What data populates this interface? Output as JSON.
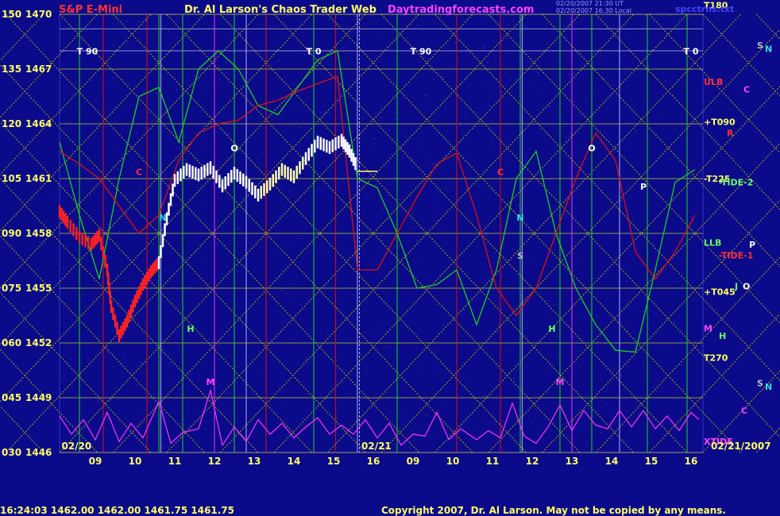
{
  "header": {
    "left_title": "S&P E-Mini",
    "center_title": "Dr. Al Larson's Chaos Trader Web",
    "site": "Daytradingforecasts.com",
    "stamp_line1": "02/20/2007 21:30 UT",
    "stamp_line2": "02/20/2007 16:30 Local",
    "file": "spcctrns.txt"
  },
  "footer": {
    "time_quote": "16:24:03  1462.00  1462.00  1461.75  1461.75",
    "copyright": "Copyright 2007, Dr. Al Larson. May not be copied by any means."
  },
  "colors": {
    "background": "#0a0a8a",
    "grid_yellow": "#c8c800",
    "green_line": "#22cc22",
    "red_line": "#dd1111",
    "magenta_line": "#ee33ee",
    "price_bar": "#ffffff"
  },
  "chart_data": {
    "type": "line",
    "title": "S&P E-Mini",
    "y_ticks": [
      {
        "code": "150",
        "price": 1470
      },
      {
        "code": "135",
        "price": 1467
      },
      {
        "code": "120",
        "price": 1464
      },
      {
        "code": "105",
        "price": 1461
      },
      {
        "code": "090",
        "price": 1458
      },
      {
        "code": "075",
        "price": 1455
      },
      {
        "code": "060",
        "price": 1452
      },
      {
        "code": "045",
        "price": 1449
      },
      {
        "code": "030",
        "price": 1446
      }
    ],
    "ylim": [
      1446,
      1470
    ],
    "x_hours_day1": [
      "09",
      "10",
      "11",
      "12",
      "13",
      "14",
      "15",
      "16"
    ],
    "x_hours_day2": [
      "09",
      "10",
      "11",
      "12",
      "13",
      "14",
      "15",
      "16"
    ],
    "x_dates": [
      "02/20",
      "02/21"
    ],
    "date_label_right": "02/21/2007",
    "price_path": [
      [
        8.5,
        1459.2
      ],
      [
        8.7,
        1458.6
      ],
      [
        9.0,
        1457.8
      ],
      [
        9.3,
        1457.4
      ],
      [
        9.5,
        1457.9
      ],
      [
        9.7,
        1456.0
      ],
      [
        9.8,
        1454.0
      ],
      [
        10.0,
        1452.4
      ],
      [
        10.2,
        1453.2
      ],
      [
        10.4,
        1454.3
      ],
      [
        10.6,
        1455.2
      ],
      [
        10.8,
        1455.9
      ],
      [
        11.0,
        1456.4
      ],
      [
        11.2,
        1458.8
      ],
      [
        11.4,
        1460.9
      ],
      [
        11.7,
        1461.5
      ],
      [
        12.0,
        1461.2
      ],
      [
        12.3,
        1461.6
      ],
      [
        12.6,
        1460.6
      ],
      [
        12.9,
        1461.3
      ],
      [
        13.2,
        1460.8
      ],
      [
        13.5,
        1460.1
      ],
      [
        13.8,
        1460.7
      ],
      [
        14.1,
        1461.5
      ],
      [
        14.4,
        1461.1
      ],
      [
        14.7,
        1462.1
      ],
      [
        15.0,
        1463.0
      ],
      [
        15.3,
        1462.7
      ],
      [
        15.6,
        1463.1
      ],
      [
        15.8,
        1462.5
      ],
      [
        16.0,
        1461.6
      ]
    ],
    "green_path": [
      [
        8.5,
        1463
      ],
      [
        9.0,
        1459
      ],
      [
        9.5,
        1455.5
      ],
      [
        10.0,
        1461
      ],
      [
        10.5,
        1465.5
      ],
      [
        11.0,
        1466
      ],
      [
        11.5,
        1463
      ],
      [
        12.0,
        1467
      ],
      [
        12.5,
        1468
      ],
      [
        13.0,
        1467
      ],
      [
        13.5,
        1465
      ],
      [
        14.0,
        1464.5
      ],
      [
        14.5,
        1466
      ],
      [
        15.0,
        1467.5
      ],
      [
        15.5,
        1468
      ],
      [
        16.0,
        1461
      ],
      [
        16.5,
        1460.5
      ],
      [
        17.0,
        1458
      ],
      [
        17.5,
        1455
      ],
      [
        18.0,
        1455.2
      ],
      [
        18.5,
        1456
      ],
      [
        19.0,
        1453
      ],
      [
        19.5,
        1456
      ],
      [
        20.0,
        1461
      ],
      [
        20.5,
        1462.5
      ],
      [
        21.0,
        1458
      ],
      [
        21.5,
        1455
      ],
      [
        22.0,
        1453
      ],
      [
        22.5,
        1451.6
      ],
      [
        23.0,
        1451.5
      ],
      [
        23.5,
        1456
      ],
      [
        24.0,
        1460.8
      ],
      [
        24.5,
        1461.5
      ]
    ],
    "red_path": [
      [
        8.5,
        1462.5
      ],
      [
        9.0,
        1461.8
      ],
      [
        9.5,
        1461.0
      ],
      [
        10.0,
        1459.5
      ],
      [
        10.5,
        1458
      ],
      [
        11.0,
        1459
      ],
      [
        11.5,
        1462
      ],
      [
        12.0,
        1463.5
      ],
      [
        12.5,
        1464
      ],
      [
        13.0,
        1464.2
      ],
      [
        13.5,
        1465
      ],
      [
        14.0,
        1465.3
      ],
      [
        14.5,
        1465.8
      ],
      [
        15.0,
        1466.2
      ],
      [
        15.5,
        1466.6
      ],
      [
        16.0,
        1456
      ],
      [
        16.5,
        1456
      ],
      [
        17.0,
        1458
      ],
      [
        17.5,
        1460
      ],
      [
        18.0,
        1461.8
      ],
      [
        18.5,
        1462.4
      ],
      [
        19.0,
        1459
      ],
      [
        19.5,
        1455
      ],
      [
        20.0,
        1453.5
      ],
      [
        20.5,
        1455
      ],
      [
        21.0,
        1458
      ],
      [
        21.5,
        1461
      ],
      [
        22.0,
        1463.5
      ],
      [
        22.5,
        1462
      ],
      [
        23.0,
        1457
      ],
      [
        23.5,
        1455.5
      ],
      [
        24.0,
        1457
      ],
      [
        24.5,
        1459
      ]
    ],
    "magenta_path": [
      [
        8.5,
        1448
      ],
      [
        8.8,
        1447
      ],
      [
        9.1,
        1447.8
      ],
      [
        9.4,
        1446.7
      ],
      [
        9.7,
        1448.2
      ],
      [
        10.0,
        1446.6
      ],
      [
        10.3,
        1447.6
      ],
      [
        10.6,
        1446.8
      ],
      [
        11.0,
        1448.8
      ],
      [
        11.3,
        1446.5
      ],
      [
        11.6,
        1447.1
      ],
      [
        12.0,
        1447.3
      ],
      [
        12.3,
        1449.4
      ],
      [
        12.6,
        1446.4
      ],
      [
        12.9,
        1447.4
      ],
      [
        13.2,
        1446.6
      ],
      [
        13.5,
        1447.8
      ],
      [
        13.8,
        1447.0
      ],
      [
        14.1,
        1447.6
      ],
      [
        14.4,
        1446.8
      ],
      [
        14.7,
        1447.4
      ],
      [
        15.0,
        1447.9
      ],
      [
        15.3,
        1447.0
      ],
      [
        15.6,
        1447.5
      ],
      [
        15.9,
        1447.0
      ],
      [
        16.2,
        1447.8
      ],
      [
        16.5,
        1446.8
      ],
      [
        16.8,
        1447.6
      ],
      [
        17.1,
        1446.4
      ],
      [
        17.4,
        1447.0
      ],
      [
        17.7,
        1446.9
      ],
      [
        18.0,
        1448.2
      ],
      [
        18.3,
        1446.7
      ],
      [
        18.6,
        1447.3
      ],
      [
        19.0,
        1446.7
      ],
      [
        19.3,
        1447.2
      ],
      [
        19.6,
        1446.8
      ],
      [
        19.9,
        1448.7
      ],
      [
        20.2,
        1446.9
      ],
      [
        20.5,
        1446.5
      ],
      [
        20.8,
        1447.4
      ],
      [
        21.1,
        1448.6
      ],
      [
        21.4,
        1447.2
      ],
      [
        21.7,
        1448.3
      ],
      [
        22.0,
        1447.5
      ],
      [
        22.3,
        1447.3
      ],
      [
        22.6,
        1448.3
      ],
      [
        22.9,
        1447.4
      ],
      [
        23.2,
        1448.3
      ],
      [
        23.5,
        1447.3
      ],
      [
        23.8,
        1448.0
      ],
      [
        24.1,
        1447.2
      ],
      [
        24.4,
        1448.2
      ],
      [
        24.6,
        1447.8
      ]
    ],
    "right_levels": [
      {
        "label": "T180",
        "price": 1470.5,
        "color": "#ffff66"
      },
      {
        "label": "ULB",
        "price": 1466.3,
        "color": "#ff3333"
      },
      {
        "label": "+T090",
        "price": 1464.1,
        "color": "#ffff66"
      },
      {
        "label": "-T225",
        "price": 1461.0,
        "color": "#ffff66"
      },
      {
        "label": "LLB",
        "price": 1457.5,
        "color": "#66ff66"
      },
      {
        "label": "+T045",
        "price": 1454.8,
        "color": "#ffff66"
      },
      {
        "label": "M",
        "price": 1452.8,
        "color": "#ff44ff"
      },
      {
        "label": "T270",
        "price": 1451.2,
        "color": "#ffff66"
      },
      {
        "label": "XTIDE",
        "price": 1446.6,
        "color": "#ff44ff"
      }
    ],
    "side_labels": [
      {
        "label": "S",
        "y": 1468.3,
        "side": 953,
        "color": "#bbbbbb"
      },
      {
        "label": "N",
        "y": 1468.1,
        "side": 963,
        "color": "#33dddd"
      },
      {
        "label": "C",
        "y": 1465.9,
        "side": 936,
        "color": "#ff44ff"
      },
      {
        "label": "R",
        "y": 1463.5,
        "side": 915,
        "color": "#ff3333"
      },
      {
        "label": "-TIDE-2",
        "y": 1460.8,
        "side": 905,
        "color": "#66ff66"
      },
      {
        "label": "P",
        "y": 1457.4,
        "side": 943,
        "color": "#ffffff"
      },
      {
        "label": "-TIDE-1",
        "y": 1456.8,
        "side": 905,
        "color": "#ff3333"
      },
      {
        "label": "J",
        "y": 1455.1,
        "side": 925,
        "color": "#66ff66"
      },
      {
        "label": "O",
        "y": 1455.1,
        "side": 935,
        "color": "#ffffff"
      },
      {
        "label": "H",
        "y": 1452.4,
        "side": 905,
        "color": "#66ff66"
      },
      {
        "label": "S",
        "y": 1449.8,
        "side": 953,
        "color": "#bbbbbb"
      },
      {
        "label": "N",
        "y": 1449.6,
        "side": 963,
        "color": "#33dddd"
      },
      {
        "label": "C",
        "y": 1448.3,
        "side": 933,
        "color": "#ff44ff"
      }
    ],
    "annotations": [
      {
        "label": "T 90",
        "x": 9.2,
        "y": 1467.8,
        "color": "#ffffff"
      },
      {
        "label": "T 0",
        "x": 14.9,
        "y": 1467.8,
        "color": "#ffffff"
      },
      {
        "label": "T 90",
        "x": 17.6,
        "y": 1467.8,
        "color": "#ffffff"
      },
      {
        "label": "T 0",
        "x": 24.4,
        "y": 1467.8,
        "color": "#ffffff"
      },
      {
        "label": "O",
        "x": 12.9,
        "y": 1462.5,
        "color": "#ffffff"
      },
      {
        "label": "O",
        "x": 21.9,
        "y": 1462.5,
        "color": "#ffffff"
      },
      {
        "label": "C",
        "x": 10.5,
        "y": 1461.2,
        "color": "#ff3333"
      },
      {
        "label": "C",
        "x": 19.6,
        "y": 1461.2,
        "color": "#ff3333"
      },
      {
        "label": "P",
        "x": 23.2,
        "y": 1460.4,
        "color": "#ffffff"
      },
      {
        "label": "N",
        "x": 11.1,
        "y": 1458.7,
        "color": "#33dddd"
      },
      {
        "label": "N",
        "x": 20.1,
        "y": 1458.7,
        "color": "#33dddd"
      },
      {
        "label": "S",
        "x": 20.1,
        "y": 1456.6,
        "color": "#bbbbbb"
      },
      {
        "label": "H",
        "x": 11.8,
        "y": 1452.6,
        "color": "#66ff66"
      },
      {
        "label": "H",
        "x": 20.9,
        "y": 1452.6,
        "color": "#66ff66"
      },
      {
        "label": "M",
        "x": 12.3,
        "y": 1449.7,
        "color": "#ff44ff"
      },
      {
        "label": "M",
        "x": 21.1,
        "y": 1449.7,
        "color": "#ff44ff"
      }
    ]
  }
}
